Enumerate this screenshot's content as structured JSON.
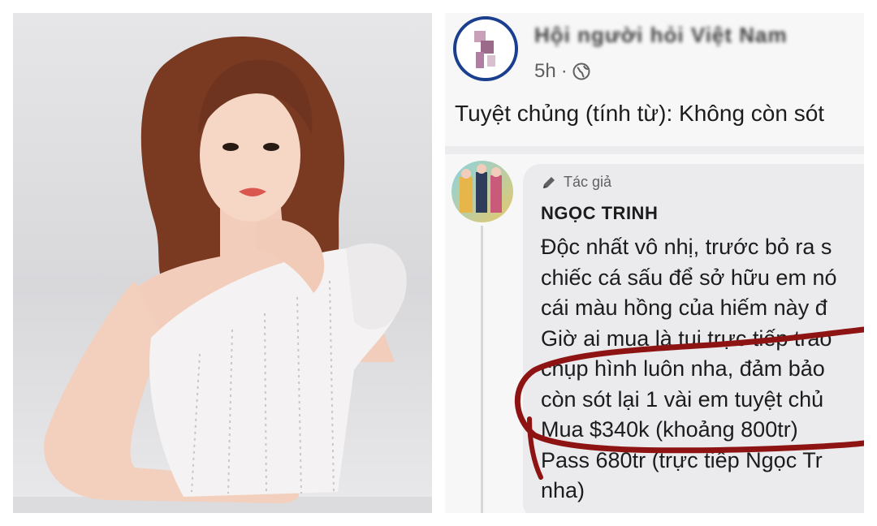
{
  "post": {
    "group_name": "Hội người hỏi Việt Nam",
    "time": "5h",
    "separator": "·",
    "text": "Tuyệt chủng (tính từ): Không còn sót"
  },
  "comment": {
    "author_badge": "Tác giả",
    "author_name": "NGỌC TRINH",
    "lines": [
      "Độc nhất vô nhị, trước bỏ ra s",
      "chiếc cá sấu để sở hữu em nó",
      "cái màu hồng của hiếm này đ",
      "Giờ ai mua là tui trực tiếp trao",
      "chụp hình luôn nha, đảm bảo",
      "còn sót lại 1 vài em tuyệt chủ",
      "Mua $340k (khoảng 800tr)",
      "Pass 680tr (trực tiếp Ngọc Tr",
      "nha)"
    ]
  },
  "colors": {
    "annotation_red": "#8e1414",
    "group_ring": "#1b3f8f"
  },
  "icons": [
    "globe-icon",
    "pencil-icon"
  ]
}
